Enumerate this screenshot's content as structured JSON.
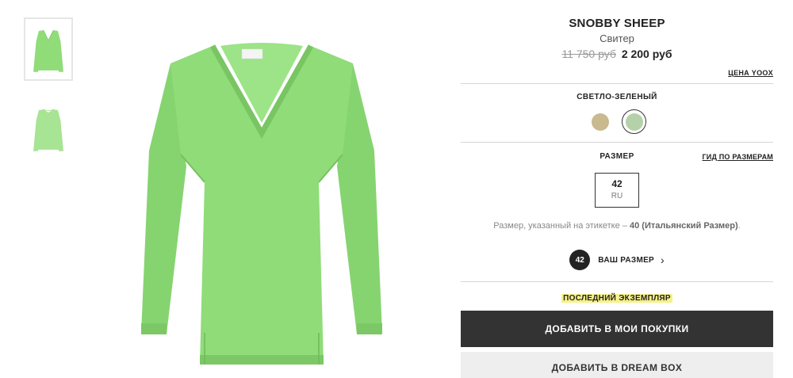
{
  "product": {
    "brand": "SNOBBY SHEEP",
    "category": "Свитер",
    "old_price": "11 750 руб",
    "new_price": "2 200 руб",
    "price_link": "ЦЕНА YOOX"
  },
  "color": {
    "name": "СВЕТЛО-ЗЕЛЕНЫЙ",
    "swatches": [
      {
        "name": "beige",
        "hex": "#c9b98f",
        "selected": false
      },
      {
        "name": "light-green",
        "hex": "#b5d1a9",
        "selected": true
      }
    ]
  },
  "size": {
    "label": "РАЗМЕР",
    "guide_link": "ГИД ПО РАЗМЕРАМ",
    "value": "42",
    "system": "RU",
    "note_prefix": "Размер, указанный на этикетке –",
    "note_bold": "40 (Итальянский Размер)",
    "note_suffix": "."
  },
  "your_size": {
    "badge": "42",
    "label": "ВАШ РАЗМЕР"
  },
  "stock_badge": "ПОСЛЕДНИЙ ЭКЗЕМПЛЯР",
  "buttons": {
    "add_to_cart": "ДОБАВИТЬ В МОИ ПОКУПКИ",
    "add_to_dreambox": "ДОБАВИТЬ В DREAM BOX"
  },
  "colors": {
    "sweater": "#8fdc79",
    "sweater_dark": "#7cc866",
    "button_dark": "#333333",
    "highlight": "#f6f18a"
  }
}
